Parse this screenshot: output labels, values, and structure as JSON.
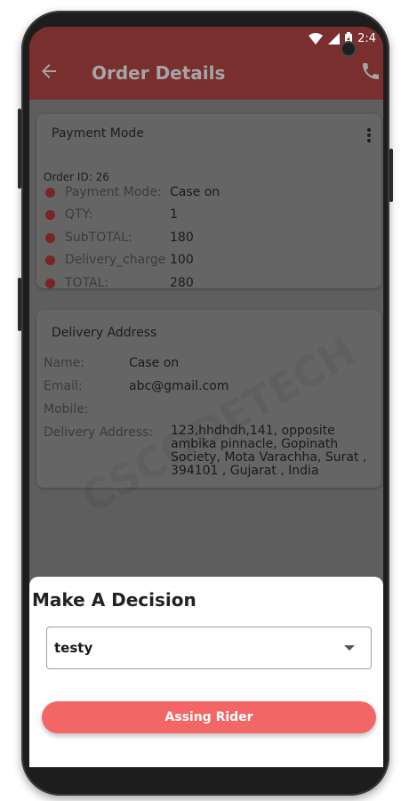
{
  "status_bar": {
    "time": "2:4"
  },
  "app_bar": {
    "title": "Order Details"
  },
  "payment_card": {
    "title": "Payment Mode",
    "order_id_label": "Order ID:",
    "order_id": "26",
    "rows": [
      {
        "label": "Payment Mode:",
        "value": "Case on"
      },
      {
        "label": "QTY:",
        "value": "1"
      },
      {
        "label": "SubTOTAL:",
        "value": "180"
      },
      {
        "label": "Delivery_charge",
        "value": "100"
      },
      {
        "label": "TOTAL:",
        "value": "280"
      }
    ]
  },
  "address_card": {
    "title": "Delivery Address",
    "name_label": "Name:",
    "name": "Case on",
    "email_label": "Email:",
    "email": "abc@gmail.com",
    "mobile_label": "Mobile:",
    "mobile": "",
    "address_label": "Delivery Address:",
    "address": "123,hhdhdh,141, opposite ambika pinnacle, Gopinath Society, Mota Varachha,  Surat , 394101 , Gujarat , India"
  },
  "watermark": "CSCODETECH",
  "decision_sheet": {
    "title": "Make A Decision",
    "selected_rider": "testy",
    "assign_button": "Assing Rider"
  },
  "colors": {
    "app_bar_dimmed": "#7a2f2f",
    "button_accent": "#f26666",
    "bullet": "#7a2424"
  }
}
